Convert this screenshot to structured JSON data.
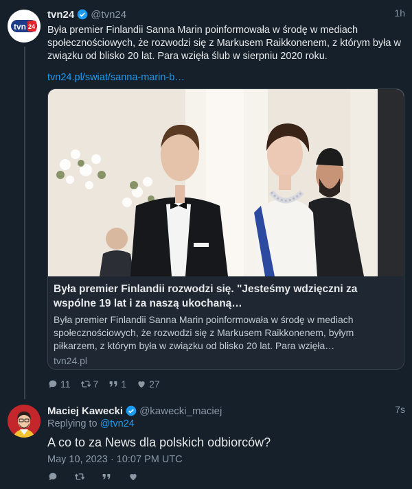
{
  "tweet": {
    "author_name": "tvn24",
    "author_handle": "@tvn24",
    "time": "1h",
    "text": "Była premier Finlandii Sanna Marin poinformowała w środę w mediach społecznościowych, że rozwodzi się z Markusem Raikkonenem, z którym była w związku od blisko 20 lat. Para wzięła ślub w sierpniu 2020 roku.",
    "link": "tvn24.pl/swiat/sanna-marin-b…",
    "card": {
      "title": "Była premier Finlandii rozwodzi się. \"Jesteśmy wdzięczni za wspólne 19 lat i za naszą ukochaną…",
      "description": "Była premier Finlandii Sanna Marin poinformowała w środę w mediach społecznościowych, że rozwodzi się z Markusem Raikkonenem, byłym piłkarzem, z którym była w związku od blisko 20 lat. Para wzięła…",
      "domain": "tvn24.pl"
    },
    "counts": {
      "replies": "11",
      "retweets": "7",
      "quotes": "1",
      "likes": "27"
    }
  },
  "reply": {
    "author_name": "Maciej Kawecki",
    "author_handle": "@kawecki_maciej",
    "time": "7s",
    "replying_label": "Replying to",
    "replying_to": "@tvn24",
    "text": "A co to za News dla polskich odbiorców?",
    "datetime": "May 10, 2023 · 10:07 PM UTC"
  },
  "logo_text": "tvn24",
  "colors": {
    "background": "#15202b",
    "accent": "#1d9bf0",
    "muted": "#8b98a5",
    "border": "#38444d"
  },
  "icons": [
    "reply-icon",
    "retweet-icon",
    "quote-icon",
    "like-icon",
    "verified-icon"
  ]
}
